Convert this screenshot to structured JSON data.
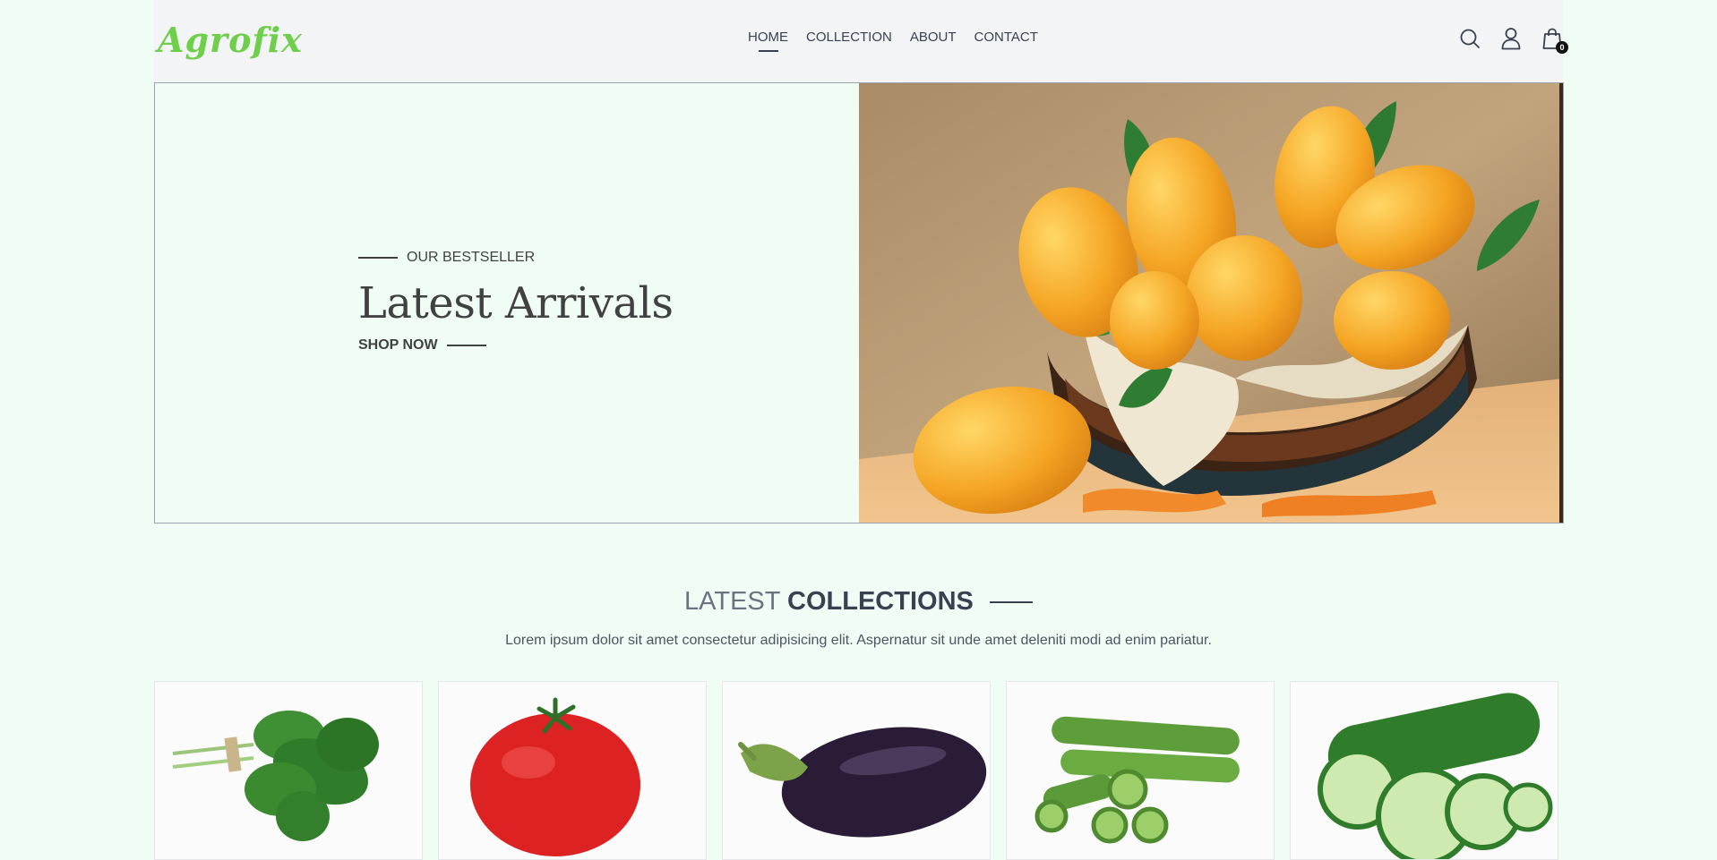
{
  "brand": {
    "logo_text": "Agrofix",
    "logo_color": "#6fcf4a"
  },
  "nav": {
    "items": [
      {
        "label": "HOME",
        "active": true
      },
      {
        "label": "COLLECTION",
        "active": false
      },
      {
        "label": "ABOUT",
        "active": false
      },
      {
        "label": "CONTACT",
        "active": false
      }
    ]
  },
  "header_icons": {
    "search": "search-icon",
    "profile": "user-icon",
    "cart": "cart-icon",
    "cart_count": "0"
  },
  "hero": {
    "kicker": "OUR BESTSELLER",
    "title": "Latest Arrivals",
    "cta": "SHOP NOW",
    "image": "mango-basket-image"
  },
  "collections": {
    "title_light": "LATEST",
    "title_bold": "COLLECTIONS",
    "subtitle": "Lorem ipsum dolor sit amet consectetur adipisicing elit. Aspernatur sit unde amet deleniti modi ad enim pariatur."
  },
  "products": [
    {
      "image": "spinach-image"
    },
    {
      "image": "tomato-image"
    },
    {
      "image": "eggplant-image"
    },
    {
      "image": "okra-image"
    },
    {
      "image": "cucumber-image"
    }
  ]
}
